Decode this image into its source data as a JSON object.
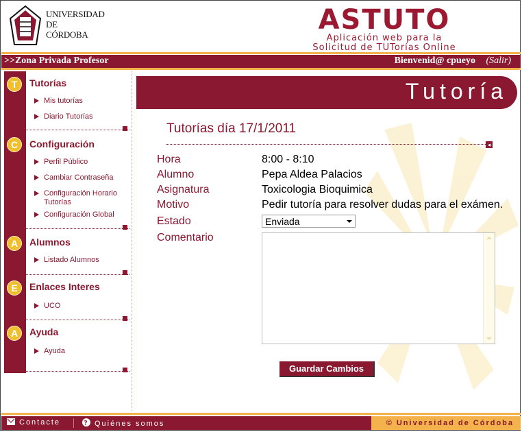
{
  "header": {
    "university_lines": [
      "UNIVERSIDAD",
      "DE",
      "CÓRDOBA"
    ],
    "app_title": "ASTUTO",
    "app_subtitle_lines": [
      "Aplicación web para la",
      "Solicitud de TUTorías Online"
    ]
  },
  "topbar": {
    "zone": ">>Zona Privada Profesor",
    "welcome": "Bienvenid@ cpueyo",
    "logout": "(Salir)"
  },
  "sidebar": {
    "sections": [
      {
        "letter": "T",
        "title": "Tutorías",
        "items": [
          "Mis tutorías",
          "Diario Tutorías"
        ]
      },
      {
        "letter": "C",
        "title": "Configuración",
        "items": [
          "Perfil Público",
          "Cambiar Contraseña",
          "Configuración Horario Tutorías",
          "Configuración Global"
        ]
      },
      {
        "letter": "A",
        "title": "Alumnos",
        "items": [
          "Listado Alumnos"
        ]
      },
      {
        "letter": "E",
        "title": "Enlaces Interes",
        "items": [
          "UCO"
        ]
      },
      {
        "letter": "A",
        "title": "Ayuda",
        "items": [
          "Ayuda"
        ]
      }
    ]
  },
  "main": {
    "banner_title": "Tutoría",
    "heading": "Tutorías día 17/1/2011",
    "fields": {
      "hora_label": "Hora",
      "hora_value": "8:00 - 8:10",
      "alumno_label": "Alumno",
      "alumno_value": "Pepa Aldea Palacios",
      "asignatura_label": "Asignatura",
      "asignatura_value": "Toxicologia Bioquimica",
      "motivo_label": "Motivo",
      "motivo_value": "Pedir tutoría para resolver dudas para el exámen.",
      "estado_label": "Estado",
      "estado_value": "Enviada",
      "comentario_label": "Comentario",
      "comentario_value": ""
    },
    "save_button": "Guardar Cambios"
  },
  "footer": {
    "contact": "Contacte",
    "about": "Quiénes somos",
    "copyright": "© Universidad de Córdoba"
  },
  "colors": {
    "brand": "#8a1830",
    "accent": "#f3b24b",
    "icon_circle": "#f0bf2b"
  }
}
